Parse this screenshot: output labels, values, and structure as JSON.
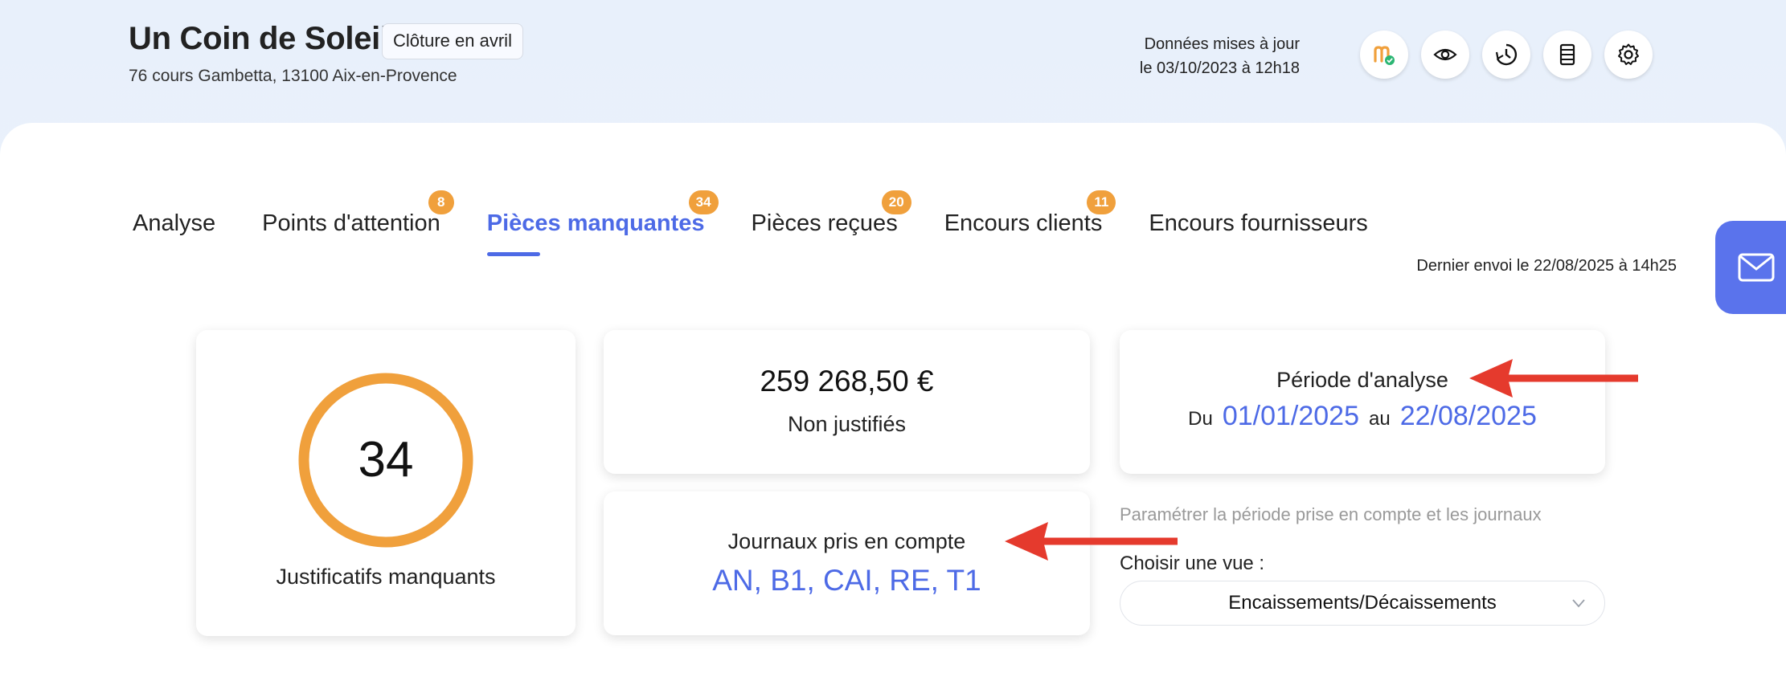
{
  "header": {
    "company_name": "Un Coin de Soleil",
    "closing_badge": "Clôture en avril",
    "address": "76 cours Gambetta, 13100 Aix-en-Provence",
    "update_line1": "Données mises à jour",
    "update_line2": "le 03/10/2023 à 12h18",
    "icons": [
      "brand-logo-icon",
      "eye-icon",
      "history-icon",
      "document-icon",
      "gear-icon"
    ]
  },
  "tabs": [
    {
      "label": "Analyse",
      "count": ""
    },
    {
      "label": "Points d'attention",
      "count": "8"
    },
    {
      "label": "Pièces manquantes",
      "count": "34",
      "active": true
    },
    {
      "label": "Pièces reçues",
      "count": "20"
    },
    {
      "label": "Encours clients",
      "count": "11"
    },
    {
      "label": "Encours fournisseurs",
      "count": ""
    }
  ],
  "last_send": "Dernier envoi le 22/08/2025 à 14h25",
  "missing": {
    "count": "34",
    "label": "Justificatifs manquants"
  },
  "amount": {
    "value": "259 268,50 €",
    "label": "Non justifiés"
  },
  "journals": {
    "title": "Journaux pris en compte",
    "list": "AN, B1, CAI, RE, T1"
  },
  "period": {
    "title": "Période d'analyse",
    "from_word": "Du",
    "from": "01/01/2025",
    "to_word": "au",
    "to": "22/08/2025"
  },
  "settings_hint": "Paramétrer la période prise en compte et les journaux",
  "view": {
    "label": "Choisir une vue :",
    "selected": "Encaissements/Décaissements"
  },
  "colors": {
    "accent": "#4d6ae6",
    "badge": "#f0a03c",
    "ring": "#f0a03c",
    "annotation": "#e53a2d",
    "mail_button": "#5a73ec"
  }
}
